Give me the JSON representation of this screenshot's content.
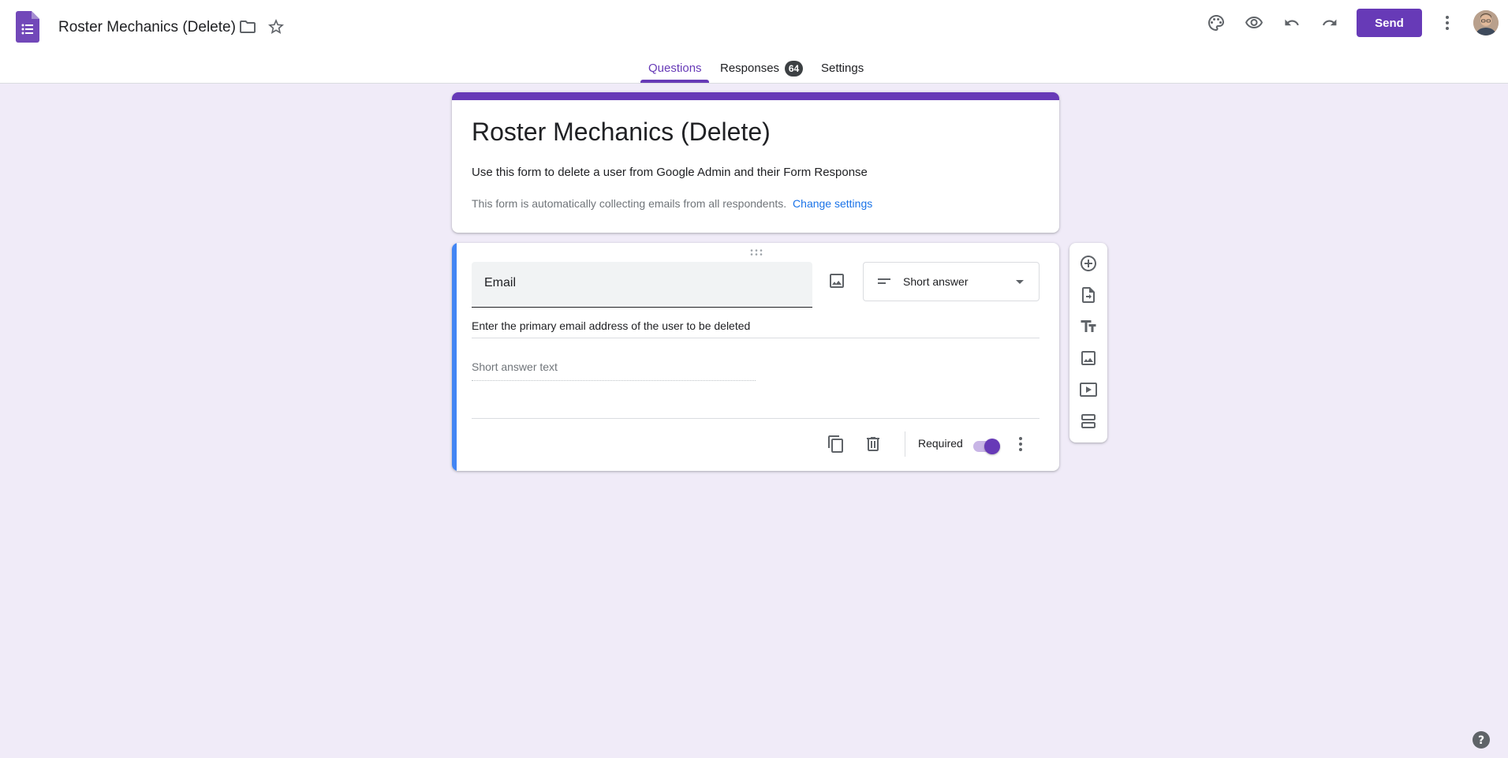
{
  "header": {
    "doc_title": "Roster Mechanics (Delete)",
    "send_label": "Send",
    "icons": [
      "forms-logo-icon",
      "folder-icon",
      "star-icon",
      "palette-icon",
      "preview-eye-icon",
      "undo-icon",
      "redo-icon",
      "more-vert-icon",
      "avatar"
    ]
  },
  "tabs": [
    {
      "label": "Questions",
      "active": true
    },
    {
      "label": "Responses",
      "badge": "64"
    },
    {
      "label": "Settings"
    }
  ],
  "form": {
    "title": "Roster Mechanics (Delete)",
    "description": "Use this form to delete a user from Google Admin and their Form Response",
    "collecting_note": "This form is automatically collecting emails from all respondents.",
    "change_settings_label": "Change settings"
  },
  "question": {
    "title": "Email",
    "type_label": "Short answer",
    "description": "Enter the primary email address of the user to be deleted",
    "answer_placeholder": "Short answer text",
    "required_label": "Required",
    "required": true
  },
  "colors": {
    "brand": "#673ab7",
    "page_bg": "#f0ebf8",
    "active_question_bar": "#4285f4",
    "link": "#1a73e8"
  }
}
